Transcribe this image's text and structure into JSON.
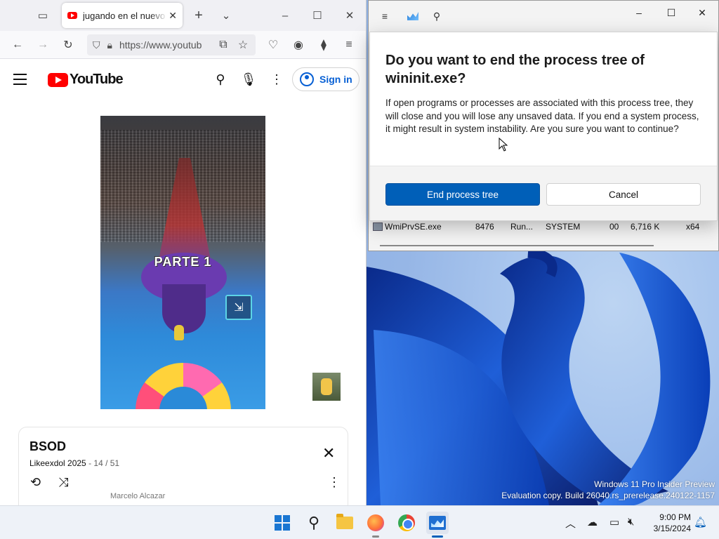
{
  "firefox": {
    "tab_title": "jugando en el nuevo n",
    "url": "https://www.youtub"
  },
  "youtube": {
    "logo_text": "YouTube",
    "sign_in": "Sign in",
    "video_overlay_text": "PARTE 1",
    "playlist": {
      "title": "BSOD",
      "channel": "Likeexdol 2025",
      "separator": " - ",
      "position": "14 / 51",
      "next_item_fragment": "Marcelo Alcazar"
    }
  },
  "task_manager": {
    "visible_row": {
      "name": "WmiPrvSE.exe",
      "pid": "8476",
      "status": "Run...",
      "user": "SYSTEM",
      "cpu": "00",
      "memory": "6,716 K",
      "arch": "x64"
    }
  },
  "dialog": {
    "title": "Do you want to end the process tree of wininit.exe?",
    "body": "If open programs or processes are associated with this process tree, they will close and you will lose any unsaved data. If you end a system process, it might result in system instability. Are you sure you want to continue?",
    "primary_button": "End process tree",
    "secondary_button": "Cancel"
  },
  "desktop": {
    "watermark_line1": "Windows 11 Pro Insider Preview",
    "watermark_line2": "Evaluation copy. Build 26040.rs_prerelease.240122-1157"
  },
  "taskbar": {
    "time": "9:00 PM",
    "date": "3/15/2024"
  },
  "colors": {
    "accent": "#005fb8",
    "youtube_red": "#ff0000",
    "youtube_link": "#065fd4"
  }
}
